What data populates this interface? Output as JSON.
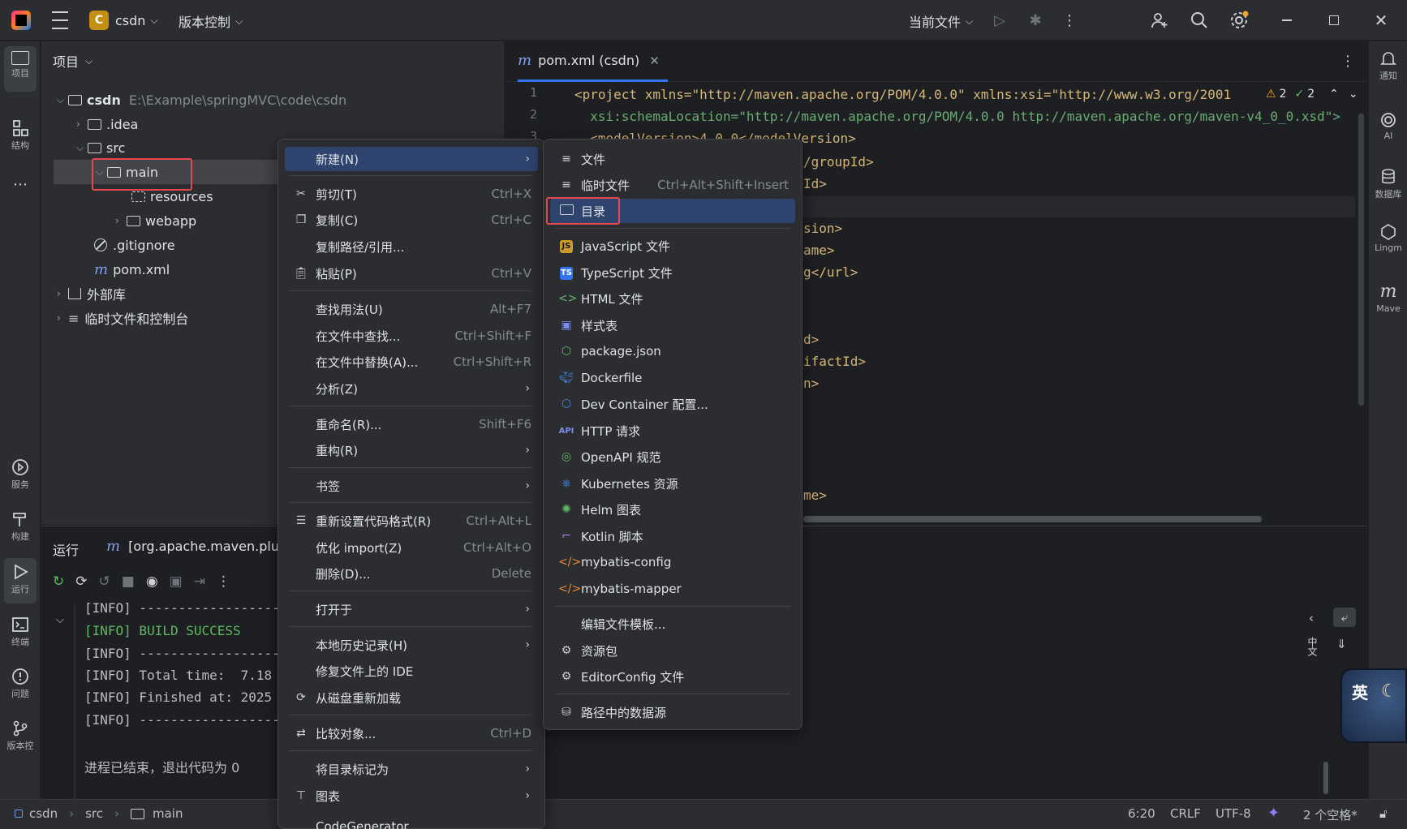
{
  "titlebar": {
    "project_badge": "C",
    "project": "csdn",
    "vcs": "版本控制",
    "run_config": "当前文件"
  },
  "left_sidebar": {
    "project": "项目",
    "structure": "结构",
    "services": "服务",
    "build": "构建",
    "run": "运行",
    "terminal": "终端",
    "problems": "问题",
    "vcs": "版本控"
  },
  "right_sidebar": {
    "notifications": "通知",
    "ai": "AI",
    "database": "数据库",
    "lingma": "Lingm",
    "maven": "Mave"
  },
  "project_panel": {
    "title": "项目",
    "tree": [
      {
        "label": "csdn",
        "path": "E:\\Example\\springMVC\\code\\csdn"
      },
      {
        "label": ".idea"
      },
      {
        "label": "src"
      },
      {
        "label": "main"
      },
      {
        "label": "resources"
      },
      {
        "label": "webapp"
      },
      {
        "label": ".gitignore"
      },
      {
        "label": "pom.xml"
      },
      {
        "label": "外部库"
      },
      {
        "label": "临时文件和控制台"
      }
    ]
  },
  "editor": {
    "tab": "pom.xml (csdn)",
    "warnings": "2",
    "checks": "2",
    "line_numbers": [
      "1",
      "2",
      "3"
    ],
    "lines": [
      "<project xmlns=\"http://maven.apache.org/POM/4.0.0\" xmlns:xsi=\"http://www.w3.org/2001",
      "  xsi:schemaLocation=\"http://maven.apache.org/POM/4.0.0 http://maven.apache.org/maven-v4_0_0.xsd\">",
      "  <modelVersion>4.0.0</modelVersion>"
    ],
    "fragments": [
      "/groupId>",
      "Id>",
      "sion>",
      "ame>",
      "g</url>",
      "d>",
      "ifactId>",
      "n>",
      "me>"
    ]
  },
  "run_panel": {
    "tab_title": "运行",
    "tab": "[org.apache.maven.plugi",
    "console": [
      "[INFO] ------------------",
      "[INFO] BUILD SUCCESS",
      "[INFO] ------------------",
      "[INFO] Total time:  7.18",
      "[INFO] Finished at: 2025",
      "[INFO] ------------------",
      "",
      "进程已结束，退出代码为 0"
    ],
    "side_label": "中文"
  },
  "context_menu": {
    "items": [
      {
        "label": "新建(N)",
        "shortcut": "",
        "arrow": true
      },
      {
        "label": "剪切(T)",
        "shortcut": "Ctrl+X"
      },
      {
        "label": "复制(C)",
        "shortcut": "Ctrl+C"
      },
      {
        "label": "复制路径/引用...",
        "shortcut": ""
      },
      {
        "label": "粘贴(P)",
        "shortcut": "Ctrl+V"
      },
      {
        "label": "查找用法(U)",
        "shortcut": "Alt+F7"
      },
      {
        "label": "在文件中查找...",
        "shortcut": "Ctrl+Shift+F"
      },
      {
        "label": "在文件中替换(A)...",
        "shortcut": "Ctrl+Shift+R"
      },
      {
        "label": "分析(Z)",
        "shortcut": ""
      },
      {
        "label": "重命名(R)...",
        "shortcut": "Shift+F6"
      },
      {
        "label": "重构(R)",
        "shortcut": ""
      },
      {
        "label": "书签",
        "shortcut": ""
      },
      {
        "label": "重新设置代码格式(R)",
        "shortcut": "Ctrl+Alt+L"
      },
      {
        "label": "优化 import(Z)",
        "shortcut": "Ctrl+Alt+O"
      },
      {
        "label": "删除(D)...",
        "shortcut": "Delete"
      },
      {
        "label": "打开于",
        "shortcut": ""
      },
      {
        "label": "本地历史记录(H)",
        "shortcut": ""
      },
      {
        "label": "修复文件上的 IDE",
        "shortcut": ""
      },
      {
        "label": "从磁盘重新加载",
        "shortcut": ""
      },
      {
        "label": "比较对象...",
        "shortcut": "Ctrl+D"
      },
      {
        "label": "将目录标记为",
        "shortcut": ""
      },
      {
        "label": "图表",
        "shortcut": ""
      },
      {
        "label": "CodeGenerator",
        "shortcut": ""
      }
    ]
  },
  "submenu": {
    "items": [
      {
        "label": "文件",
        "shortcut": ""
      },
      {
        "label": "临时文件",
        "shortcut": "Ctrl+Alt+Shift+Insert"
      },
      {
        "label": "目录",
        "shortcut": ""
      },
      {
        "label": "JavaScript 文件"
      },
      {
        "label": "TypeScript 文件"
      },
      {
        "label": "HTML 文件"
      },
      {
        "label": "样式表"
      },
      {
        "label": "package.json"
      },
      {
        "label": "Dockerfile"
      },
      {
        "label": "Dev Container 配置..."
      },
      {
        "label": "HTTP 请求"
      },
      {
        "label": "OpenAPI 规范"
      },
      {
        "label": "Kubernetes 资源"
      },
      {
        "label": "Helm 图表"
      },
      {
        "label": "Kotlin 脚本"
      },
      {
        "label": "mybatis-config"
      },
      {
        "label": "mybatis-mapper"
      },
      {
        "label": "编辑文件模板..."
      },
      {
        "label": "资源包"
      },
      {
        "label": "EditorConfig 文件"
      },
      {
        "label": "路径中的数据源"
      }
    ],
    "badges": {
      "js": "JS",
      "ts": "TS",
      "api": "API"
    }
  },
  "statusbar": {
    "crumb1": "csdn",
    "crumb2": "src",
    "crumb3": "main",
    "position": "6:20",
    "line_sep": "CRLF",
    "encoding": "UTF-8",
    "indent": "2 个空格*"
  },
  "ime": {
    "label": "英"
  },
  "colors": {
    "accent": "#2e436e",
    "highlight": "#e5484d",
    "bg": "#1e1f22",
    "panel": "#2b2d30"
  }
}
